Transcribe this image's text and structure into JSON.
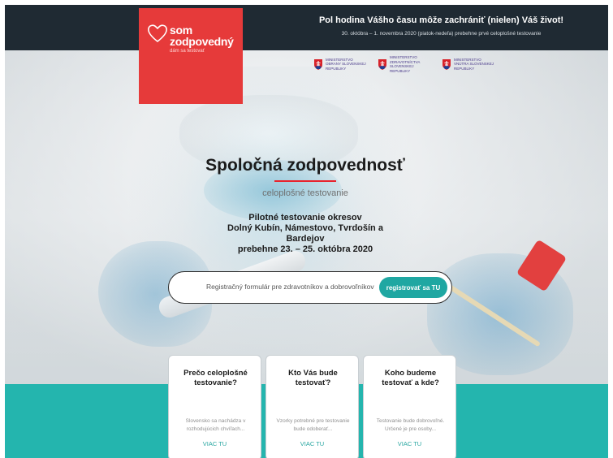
{
  "header": {
    "logo_title": "som\nzodpovedný",
    "logo_subtitle": "dám sa testovať",
    "title": "Pol hodina Vášho času môže zachrániť (nielen) Váš život!",
    "subtitle": "30. októbra – 1. novembra 2020 (piatok-nedeľa) prebehne prvé celoplošné testovanie"
  },
  "ministries": [
    {
      "label": "MINISTERSTVO OBRANY SLOVENSKEJ REPUBLIKY"
    },
    {
      "label": "MINISTERSTVO ZDRAVOTNÍCTVA SLOVENSKEJ REPUBLIKY"
    },
    {
      "label": "MINISTERSTVO VNÚTRA SLOVENSKEJ REPUBLIKY"
    }
  ],
  "hero": {
    "title": "Spoločná zodpovednosť",
    "subtitle": "celoplošné testovanie",
    "pilot": "Pilotné testovanie okresov\nDolný Kubín, Námestovo, Tvrdošín a Bardejov\nprebehne 23. – 25. októbra 2020"
  },
  "registration": {
    "text": "Registračný formulár pre zdravotníkov a dobrovoľníkov",
    "button_label": "registrovať sa TU"
  },
  "cards": [
    {
      "title": "Prečo celoplošné testovanie?",
      "text": "Slovensko sa nachádza v rozhodujúcich chvíľach...",
      "link": "VIAC TU"
    },
    {
      "title": "Kto Vás bude testovať?",
      "text": "Vzorky potrebné pre testovanie bude odoberať...",
      "link": "VIAC TU"
    },
    {
      "title": "Koho budeme testovať a kde?",
      "text": "Testovanie bude dobrovoľné. Určené je pre osoby...",
      "link": "VIAC TU"
    }
  ],
  "colors": {
    "header_bg": "#1f2a33",
    "logo_red": "#e63a3a",
    "accent_teal": "#24b5ae",
    "button_teal": "#1fa7a2"
  }
}
